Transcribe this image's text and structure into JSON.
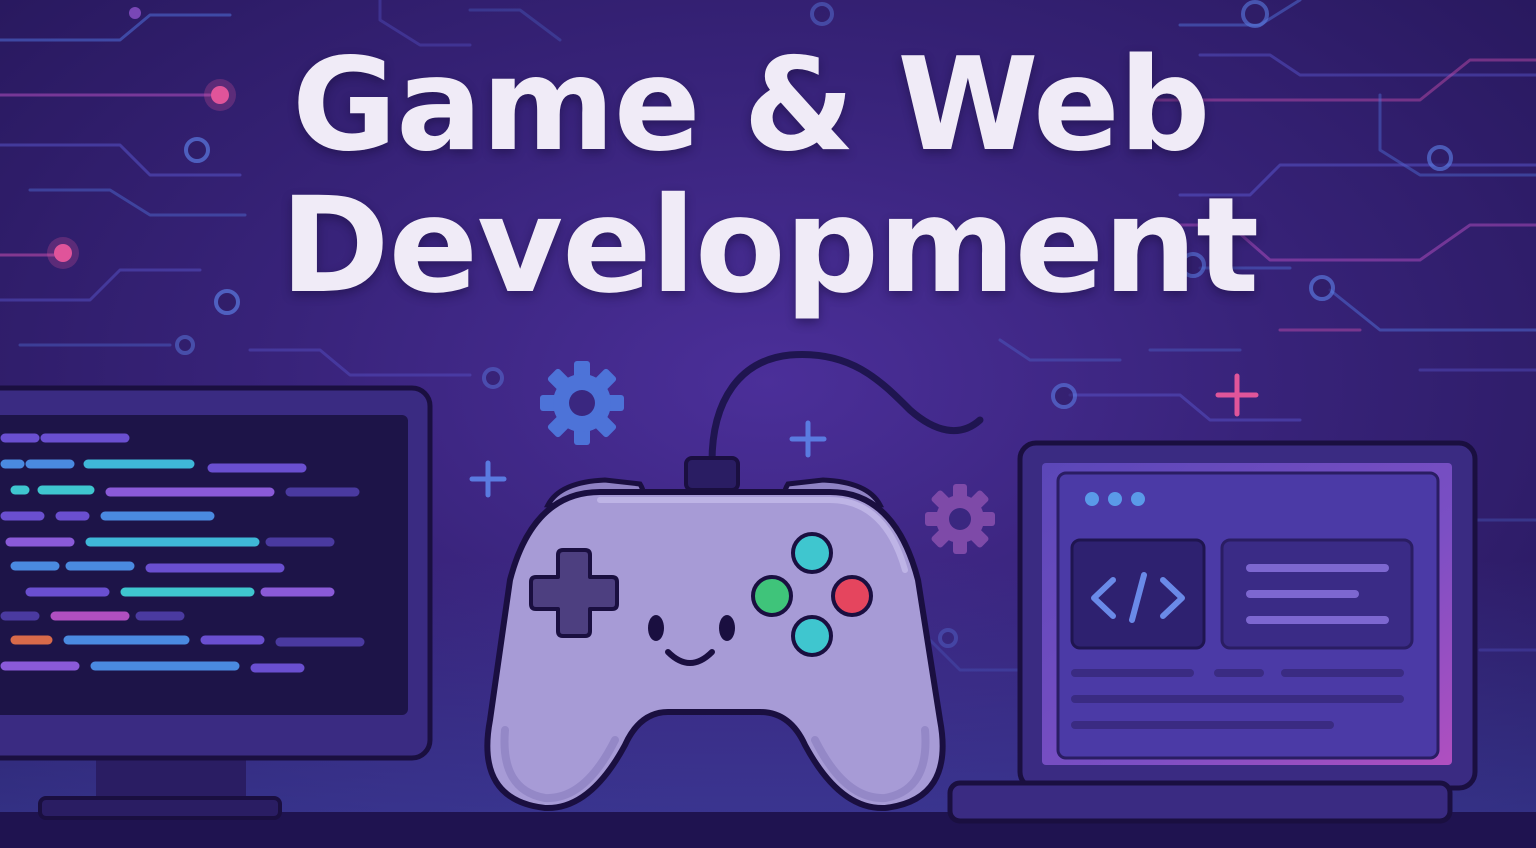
{
  "title": {
    "line1": "Game & Web",
    "line2": "Development"
  },
  "illustration": {
    "left": "monitor-with-code",
    "center": "smiling-game-controller",
    "right": "laptop-with-web-page",
    "decorations": [
      "gear-icon",
      "plus-icon",
      "circuit-lines"
    ]
  },
  "colors": {
    "background": "#38237a",
    "title_text": "#f0ebf7",
    "controller_body": "#a79bd6",
    "button_teal": "#3fc6cf",
    "button_green": "#3fc47a",
    "button_red": "#e5455e",
    "accent_pink": "#e0559a",
    "accent_blue": "#4a7de0"
  }
}
